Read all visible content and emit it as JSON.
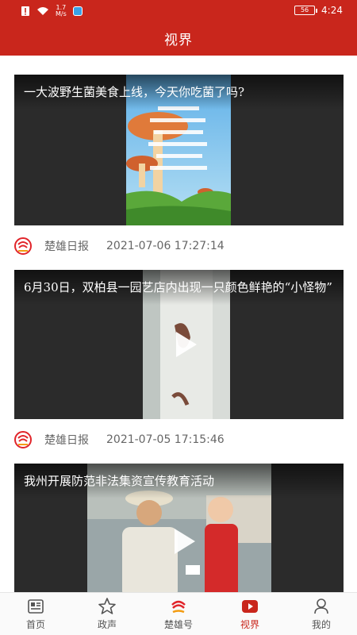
{
  "status_bar": {
    "network_speed": "1.7\nM/s",
    "battery": "56",
    "time": "4:24"
  },
  "header": {
    "title": "视界"
  },
  "feed": [
    {
      "caption": "一大波野生菌美食上线，今天你吃菌了吗?",
      "source": "楚雄日报",
      "datetime": "2021-07-06 17:27:14"
    },
    {
      "caption": "6月30日，双柏县一园艺店内出现一只颜色鲜艳的“小怪物”",
      "source": "楚雄日报",
      "datetime": "2021-07-05 17:15:46"
    },
    {
      "caption": "我州开展防范非法集资宣传教育活动"
    }
  ],
  "nav": [
    {
      "label": "首页",
      "icon": "news-icon"
    },
    {
      "label": "政声",
      "icon": "star-icon"
    },
    {
      "label": "楚雄号",
      "icon": "chuxiong-logo-icon"
    },
    {
      "label": "视界",
      "icon": "video-play-icon",
      "active": true
    },
    {
      "label": "我的",
      "icon": "user-icon"
    }
  ],
  "colors": {
    "brand_red": "#c9261c",
    "card_bg": "#2b2b2b"
  }
}
